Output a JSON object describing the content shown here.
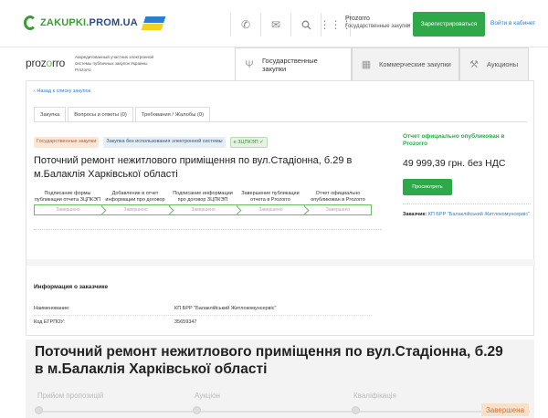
{
  "topbar": {
    "logo_text_1": "ZAKUPKI.",
    "logo_text_2": "PROM.UA",
    "icons": [
      "phone-icon",
      "mail-icon",
      "search-icon",
      "grid-icon"
    ],
    "prozorro_title": "Prozorro",
    "prozorro_sub": "Государственные закупки",
    "register_label": "Зарегистрироваться",
    "login_label": "Войти в кабинет"
  },
  "header": {
    "prozorro_logo_1": "proz",
    "prozorro_logo_2": "o",
    "prozorro_logo_3": "rro",
    "description": "Аккредитованный участник электронной системы публичных закупок Украины Prozorro",
    "tabs": [
      {
        "label": "Государственные закупки",
        "active": true
      },
      {
        "label": "Коммерческие закупки",
        "active": false
      },
      {
        "label": "Аукционы",
        "active": false
      }
    ]
  },
  "main": {
    "back_label": "‹ Назад к списку закупок",
    "tabs": [
      "Закупка",
      "Вопросы и ответы  (0)",
      "Требования / Жалобы  (0)"
    ],
    "badges": [
      "Государственные закупки",
      "Закупка без использования электронной системы",
      "е ЗЦПКЭП ✓"
    ],
    "title": "Поточний ремонт нежитлового приміщення по вул.Стадіонна, б.29 в м.Балаклія Харківської області",
    "steps": [
      {
        "label": "Подписание формы публикации отчета ЗЦПКЭП",
        "status": "Завершено"
      },
      {
        "label": "Добавление в отчет информации про договор",
        "status": "Завершено"
      },
      {
        "label": "Подписание информации про договор ЗЦПКЭП",
        "status": "Завершено"
      },
      {
        "label": "Завершение публикации отчета в Prozorro",
        "status": "Завершено"
      },
      {
        "label": "Отчет официально опубликован в Prozorro",
        "status": "Завершено"
      }
    ],
    "publication": "Отчет официально опубликован в Prozorro",
    "price": "49 999,39 грн. без НДС",
    "view_label": "Просмотреть",
    "customer_label": "Заказчик:",
    "customer_value": "КП БРР \"Балаклійський Житлокомунсервіс\"",
    "info_heading": "Информация о заказчике",
    "info_rows": [
      {
        "label": "Наименование:",
        "value": "КП БРР \"Балаклійський Житлокомунсервіс\""
      },
      {
        "label": "Код ЕГРПОУ:",
        "value": "35659347"
      }
    ]
  },
  "bottom": {
    "title": "Поточний ремонт нежитлового приміщення по вул.Стадіонна, б.29 в м.Балаклія Харківської області",
    "steps": [
      "Прийом пропозицій",
      "Аукціон",
      "Кваліфікація",
      "Завершена"
    ]
  }
}
